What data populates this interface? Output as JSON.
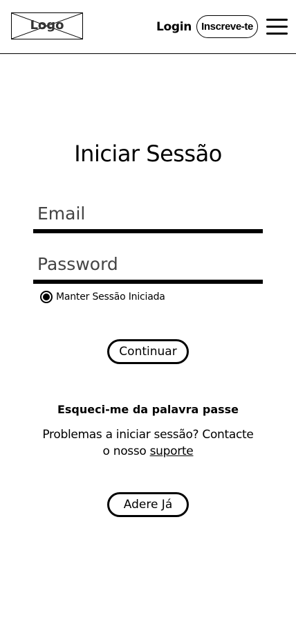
{
  "header": {
    "logo_text": "Logo",
    "login_label": "Login",
    "signup_label": "Inscreve-te",
    "menu_icon": "hamburger-menu-icon"
  },
  "main": {
    "title": "Iniciar Sessão",
    "email_placeholder": "Email",
    "password_placeholder": "Password",
    "remember_label": "Manter Sessão Iniciada",
    "remember_checked": true,
    "continue_label": "Continuar",
    "forgot_label": "Esqueci-me da palavra passe",
    "help_text": "Problemas a iniciar sessão? Contacte o nosso",
    "support_link": "suporte",
    "join_label": "Adere Já"
  }
}
